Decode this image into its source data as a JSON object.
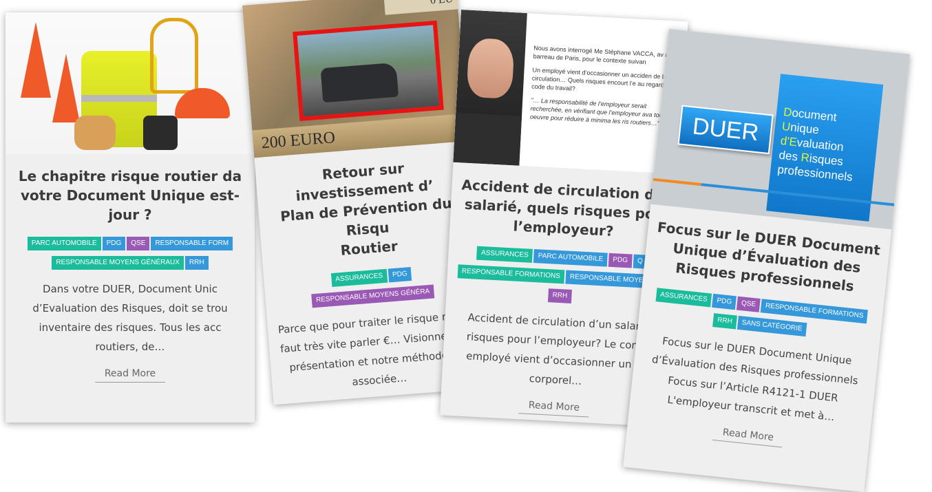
{
  "cards": [
    {
      "title": "Le chapitre risque routier dans votre Document Unique est-il à jour ?",
      "title_visible": "Le chapitre risque routier da votre Document Unique est- jour ?",
      "title_lines": [
        "Le chapitre risque routier da",
        "votre Document Unique est-",
        "jour ?"
      ],
      "tags": [
        {
          "label": "PARC AUTOMOBILE",
          "color": "#1abc9c"
        },
        {
          "label": "PDG",
          "color": "#3498db"
        },
        {
          "label": "QSE",
          "color": "#9b59b6"
        },
        {
          "label": "RESPONSABLE FORM",
          "color": "#3498db"
        },
        {
          "label": "RESPONSABLE MOYENS GÉNÉRAUX",
          "color": "#1abc9c"
        },
        {
          "label": "RRH",
          "color": "#3498db"
        }
      ],
      "excerpt_lines": [
        "Dans votre DUER, Document Unic",
        "d’Evaluation des Risques, doit se trou",
        "inventaire des risques. Tous les acc",
        "routiers, de…"
      ],
      "read_more": "Read More",
      "image_icon": "safety-equipment-image"
    },
    {
      "title_lines": [
        "Retour sur investissement d’",
        "Plan de Prévention du Risqu",
        "Routier"
      ],
      "tags": [
        {
          "label": "ASSURANCES",
          "color": "#1abc9c"
        },
        {
          "label": "PDG",
          "color": "#3498db"
        },
        {
          "label": "RESPONSABLE MOYENS GÉNÉRA",
          "color": "#9b59b6"
        }
      ],
      "excerpt_lines": [
        "Parce que pour traiter le risque routie",
        "faut très vite parler €… Visionnez not",
        "présentation et notre méthodologi",
        "associée…"
      ],
      "read_more": "Read More",
      "image_icon": "money-car-crash-image",
      "image_text": {
        "note": "200 EURO",
        "corner": "0 EU"
      }
    },
    {
      "title_lines": [
        "Accident de circulation d’u",
        "salarié, quels risques pou",
        "l’employeur?"
      ],
      "tags": [
        {
          "label": "ASSURANCES",
          "color": "#1abc9c"
        },
        {
          "label": "PARC AUTOMOBILE",
          "color": "#3498db"
        },
        {
          "label": "PDG",
          "color": "#9b59b6"
        },
        {
          "label": "Q",
          "color": "#3498db"
        },
        {
          "label": "RESPONSABLE FORMATIONS",
          "color": "#1abc9c"
        },
        {
          "label": "RESPONSABLE MOYENS G",
          "color": "#3498db"
        },
        {
          "label": "RRH",
          "color": "#9b59b6"
        }
      ],
      "excerpt_lines": [
        "Accident de circulation d’un salarié",
        "risques pour l’employeur?   Le conte",
        "employé vient d’occasionner un ac",
        "corporel…"
      ],
      "read_more": "Read More",
      "image_icon": "lawyer-portrait-image",
      "image_text": [
        "Nous avons interrogé Me Stéphane VACCA, av au barreau de Paris, pour le contexte suivan",
        "Un employé vient d’occasionner un acciden de la circulation… Quels risques encourt l’e au regard du code du travail?",
        "\"… La responsabilité de l’employeur serait recherchée, en vérifiant que l’employeur ava tout en oeuvre pour réduire à minima les ris routiers…\""
      ]
    },
    {
      "title_lines": [
        "Focus sur le DUER Document",
        "Unique d’Évaluation des",
        "Risques professionnels"
      ],
      "tags": [
        {
          "label": "ASSURANCES",
          "color": "#1abc9c"
        },
        {
          "label": "PDG",
          "color": "#3498db"
        },
        {
          "label": "QSE",
          "color": "#9b59b6"
        },
        {
          "label": "RESPONSABLE FORMATIONS",
          "color": "#3498db"
        },
        {
          "label": "RRH",
          "color": "#1abc9c"
        },
        {
          "label": "SANS CATÉGORIE",
          "color": "#3498db"
        }
      ],
      "excerpt_lines": [
        "Focus sur le DUER Document Unique",
        "d’Évaluation des Risques professionnels",
        "Focus sur l’Article R4121-1    DUER",
        "L'employeur transcrit et met à…"
      ],
      "read_more": "Read More",
      "image_icon": "duer-logo-image",
      "image_text": {
        "button": "DUER",
        "box_lines": [
          {
            "hl": "D",
            "rest": "ocument"
          },
          {
            "hl": "U",
            "rest": "nique"
          },
          {
            "hl": "d'E",
            "rest": "valuation"
          },
          {
            "hl": "",
            "rest": "des "
          },
          {
            "hl": "R",
            "rest": "isques"
          },
          {
            "hl": "",
            "rest": "professionnels"
          }
        ]
      }
    }
  ]
}
